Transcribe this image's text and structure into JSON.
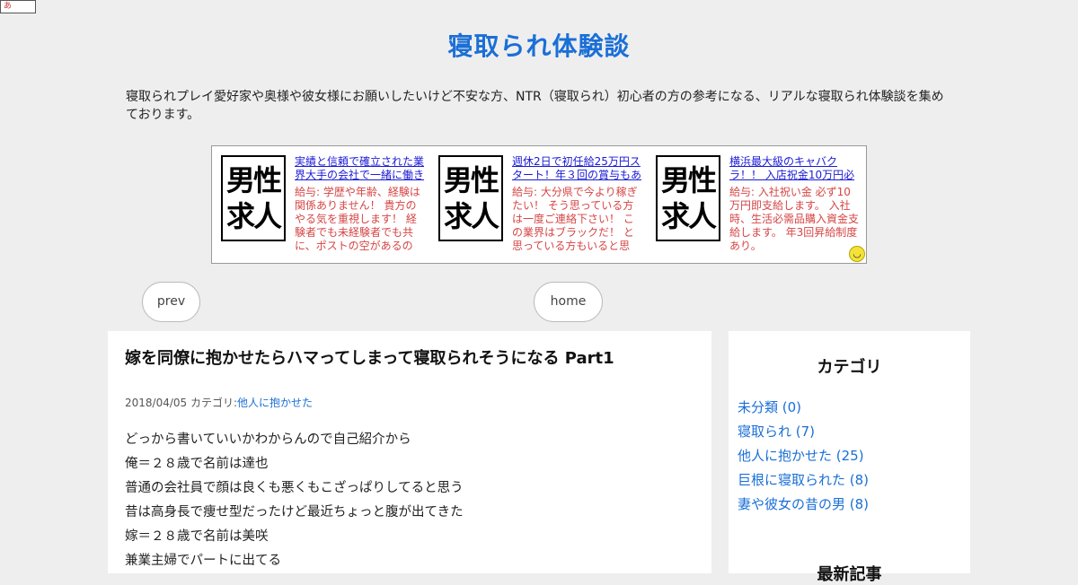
{
  "corner_badge": "あ",
  "site": {
    "title": "寝取られ体験談",
    "description": "寝取られプレイ愛好家や奥様や彼女様にお願いしたいけど不安な方、NTR（寝取られ）初心者の方の参考になる、リアルな寝取られ体験談を集めております。"
  },
  "ads": [
    {
      "logo_top": "男性",
      "logo_bottom": "求人",
      "title": "実績と信頼で確立された業界大手の会社で一緒に働き",
      "body": "給与: 学歴や年齢、経験は関係ありません！ 貴方のやる気を重視します！ 経験者でも未経験者でも共に、ポストの空があるの"
    },
    {
      "logo_top": "男性",
      "logo_bottom": "求人",
      "title": "週休2日で初任給25万円スタート！年３回の賞与もあ",
      "body": "給与: 大分県で今より稼ぎたい！ そう思っている方は一度ご連絡下さい！ この業界はブラックだ！ と思っている方もいると思"
    },
    {
      "logo_top": "男性",
      "logo_bottom": "求人",
      "title": "横浜最大級のキャバクラ！！ 入店祝金10万円必",
      "body": "給与: 入社祝い金 必ず10万円即支給します。 入社時、生活必需品購入資金支給します。 年3回昇給制度あり。"
    }
  ],
  "nav": {
    "prev_label": "prev",
    "home_label": "home"
  },
  "post": {
    "title": "嫁を同僚に抱かせたらハマってしまって寝取られそうになる Part1",
    "date": "2018/04/05",
    "category_prefix": "カテゴリ:",
    "category": "他人に抱かせた",
    "lines": [
      "どっから書いていいかわからんので自己紹介から",
      "俺＝２８歳で名前は達也",
      "普通の会社員で顔は良くも悪くもこざっぱりしてると思う",
      "昔は高身長で痩せ型だったけど最近ちょっと腹が出てきた",
      "嫁＝２８歳で名前は美咲",
      "兼業主婦でパートに出てる"
    ]
  },
  "sidebar": {
    "category_heading": "カテゴリ",
    "categories": [
      {
        "label": "未分類 (0)"
      },
      {
        "label": "寝取られ (7)"
      },
      {
        "label": "他人に抱かせた (25)"
      },
      {
        "label": "巨根に寝取られた (8)"
      },
      {
        "label": "妻や彼女の昔の男 (8)"
      }
    ],
    "recent_heading": "最新記事"
  },
  "colors": {
    "accent": "#1a6fd6",
    "ad_body": "#d64545",
    "background": "#eeeeee"
  }
}
